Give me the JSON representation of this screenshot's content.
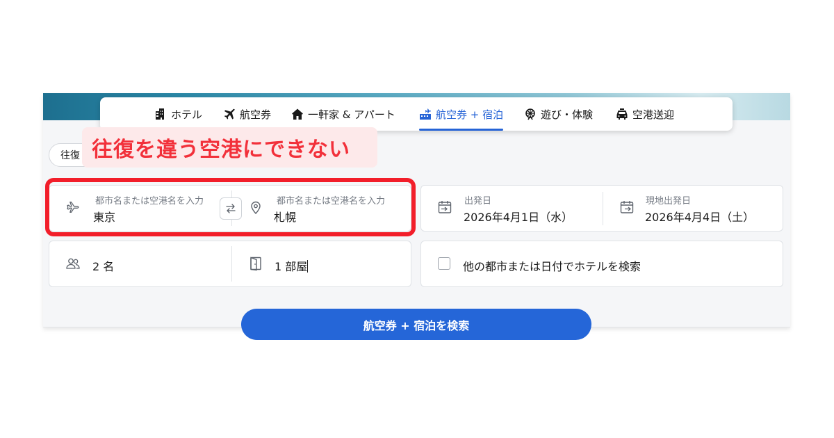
{
  "tabs": [
    {
      "label": "ホテル",
      "icon": "building-icon",
      "active": false
    },
    {
      "label": "航空券",
      "icon": "airplane-icon",
      "active": false
    },
    {
      "label": "一軒家 & アパート",
      "icon": "house-icon",
      "active": false
    },
    {
      "label": "航空券 + 宿泊",
      "icon": "flight-hotel-icon",
      "active": true
    },
    {
      "label": "遊び・体験",
      "icon": "ferris-wheel-icon",
      "active": false
    },
    {
      "label": "空港送迎",
      "icon": "car-icon",
      "active": false
    }
  ],
  "trip_type": {
    "label": "往復"
  },
  "callout": {
    "text": "往復を違う空港にできない"
  },
  "origin": {
    "placeholder": "都市名または空港名を入力",
    "value": "東京"
  },
  "destination": {
    "placeholder": "都市名または空港名を入力",
    "value": "札幌"
  },
  "depart": {
    "label": "出発日",
    "value": "2026年4月1日（水）"
  },
  "return": {
    "label": "現地出発日",
    "value": "2026年4月4日（土）"
  },
  "guests": {
    "value": "2 名"
  },
  "rooms": {
    "value": "1 部屋"
  },
  "hotel_option": {
    "label": "他の都市または日付でホテルを検索",
    "checked": false
  },
  "search_button": {
    "label": "航空券 + 宿泊を検索"
  },
  "colors": {
    "accent": "#2566d8",
    "callout_text": "#f2303a",
    "callout_bg": "#fde9ea",
    "highlight_frame": "#f21e2a"
  }
}
